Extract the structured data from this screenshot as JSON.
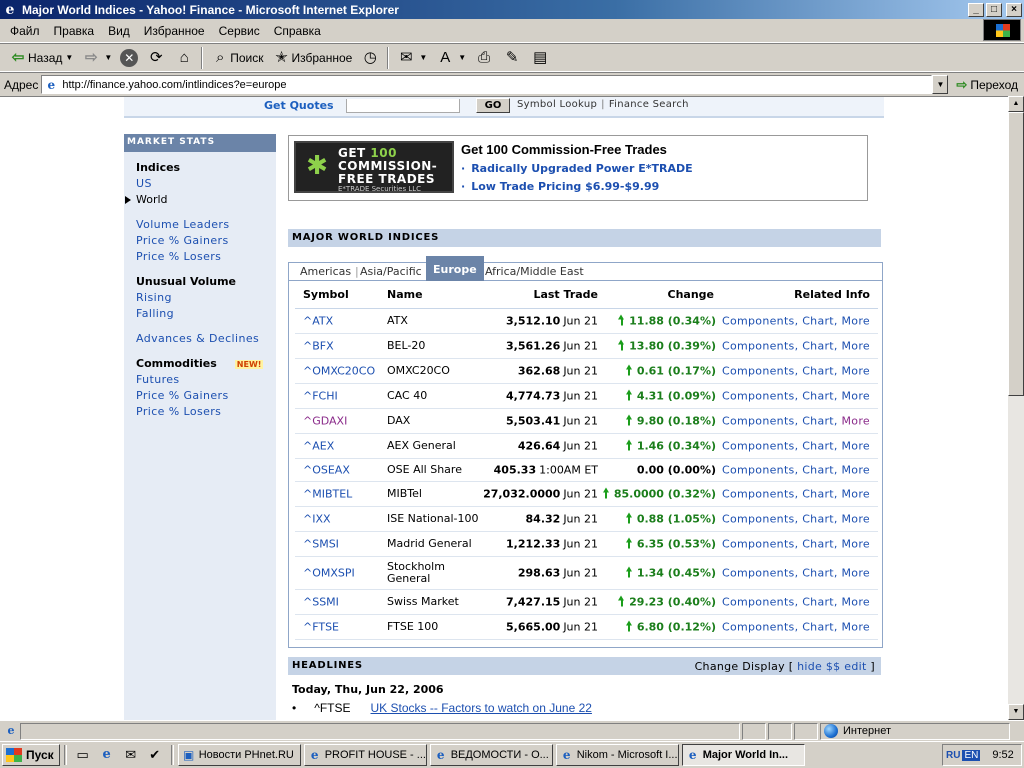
{
  "window": {
    "title": "Major World Indices - Yahoo! Finance - Microsoft Internet Explorer",
    "min": "_",
    "max": "□",
    "close": "×"
  },
  "menu": [
    "Файл",
    "Правка",
    "Вид",
    "Избранное",
    "Сервис",
    "Справка"
  ],
  "toolbar": {
    "back_label": "Назад",
    "search_label": "Поиск",
    "favorites_label": "Избранное"
  },
  "address": {
    "label": "Адрес",
    "url": "http://finance.yahoo.com/intlindices?e=europe",
    "go_label": "Переход"
  },
  "quotebar": {
    "label": "Get Quotes",
    "go": "GO",
    "symbol_lookup": "Symbol Lookup",
    "finance_search": "Finance Search"
  },
  "leftnav": {
    "header": "MARKET STATS",
    "indices_title": "Indices",
    "us": "US",
    "world": "World",
    "volume_leaders": "Volume Leaders",
    "price_gainers": "Price % Gainers",
    "price_losers": "Price % Losers",
    "unusual_title": "Unusual Volume",
    "rising": "Rising",
    "falling": "Falling",
    "advances": "Advances & Declines",
    "commodities_title": "Commodities",
    "new_badge": "NEW!",
    "futures": "Futures",
    "c_gainers": "Price % Gainers",
    "c_losers": "Price % Losers"
  },
  "ad": {
    "banner_get": "GET",
    "banner_num": "100",
    "banner_l2": "COMMISSION-",
    "banner_l3": "FREE TRADES",
    "banner_l4": "E*TRADE Securities LLC",
    "title": "Get 100 Commission-Free Trades",
    "line1": "Radically Upgraded Power E*TRADE",
    "line2": "Low Trade Pricing $6.99-$9.99"
  },
  "indices": {
    "header": "MAJOR WORLD INDICES",
    "tabs": [
      "Americas",
      "Asia/Pacific",
      "Europe",
      "Africa/Middle East"
    ],
    "columns": {
      "symbol": "Symbol",
      "name": "Name",
      "last": "Last Trade",
      "change": "Change",
      "related": "Related Info"
    },
    "rows": [
      {
        "symbol": "^ATX",
        "name": "ATX",
        "last": "3,512.10",
        "date": "Jun 21",
        "change": "11.88 (0.34%)"
      },
      {
        "symbol": "^BFX",
        "name": "BEL-20",
        "last": "3,561.26",
        "date": "Jun 21",
        "change": "13.80 (0.39%)"
      },
      {
        "symbol": "^OMXC20CO",
        "name": "OMXC20CO",
        "last": "362.68",
        "date": "Jun 21",
        "change": "0.61 (0.17%)"
      },
      {
        "symbol": "^FCHI",
        "name": "CAC 40",
        "last": "4,774.73",
        "date": "Jun 21",
        "change": "4.31 (0.09%)"
      },
      {
        "symbol": "^GDAXI",
        "name": "DAX",
        "last": "5,503.41",
        "date": "Jun 21",
        "change": "9.80 (0.18%)"
      },
      {
        "symbol": "^AEX",
        "name": "AEX General",
        "last": "426.64",
        "date": "Jun 21",
        "change": "1.46 (0.34%)"
      },
      {
        "symbol": "^OSEAX",
        "name": "OSE All Share",
        "last": "405.33",
        "date": "1:00AM ET",
        "change": "0.00 (0.00%)"
      },
      {
        "symbol": "^MIBTEL",
        "name": "MIBTel",
        "last": "27,032.0000",
        "date": "Jun 21",
        "change": "85.0000 (0.32%)"
      },
      {
        "symbol": "^IXX",
        "name": "ISE National-100",
        "last": "84.32",
        "date": "Jun 21",
        "change": "0.88 (1.05%)"
      },
      {
        "symbol": "^SMSI",
        "name": "Madrid General",
        "last": "1,212.33",
        "date": "Jun 21",
        "change": "6.35 (0.53%)"
      },
      {
        "symbol": "^OMXSPI",
        "name": "Stockholm",
        "name2": "General",
        "last": "298.63",
        "date": "Jun 21",
        "change": "1.34 (0.45%)"
      },
      {
        "symbol": "^SSMI",
        "name": "Swiss Market",
        "last": "7,427.15",
        "date": "Jun 21",
        "change": "29.23 (0.40%)"
      },
      {
        "symbol": "^FTSE",
        "name": "FTSE 100",
        "last": "5,665.00",
        "date": "Jun 21",
        "change": "6.80 (0.12%)"
      }
    ],
    "related": {
      "components": "Components",
      "chart": "Chart",
      "more": "More"
    }
  },
  "headlines": {
    "header": "HEADLINES",
    "change_display": "Change Display",
    "hide": "hide $$",
    "edit": "edit",
    "date": "Today, Thu, Jun 22, 2006",
    "items": [
      {
        "symbol": "^FTSE",
        "title": "UK Stocks -- Factors to watch on June 22"
      }
    ]
  },
  "status": {
    "zone": "Интернет"
  },
  "taskbar": {
    "start": "Пуск",
    "tasks": [
      "Новости PHnet.RU",
      "PROFIT HOUSE - ...",
      "ВЕДОМОСТИ - О...",
      "Nikom - Microsoft I...",
      "Major World In..."
    ],
    "lang_ru": "RU",
    "lang": "EN",
    "time": "9:52"
  }
}
